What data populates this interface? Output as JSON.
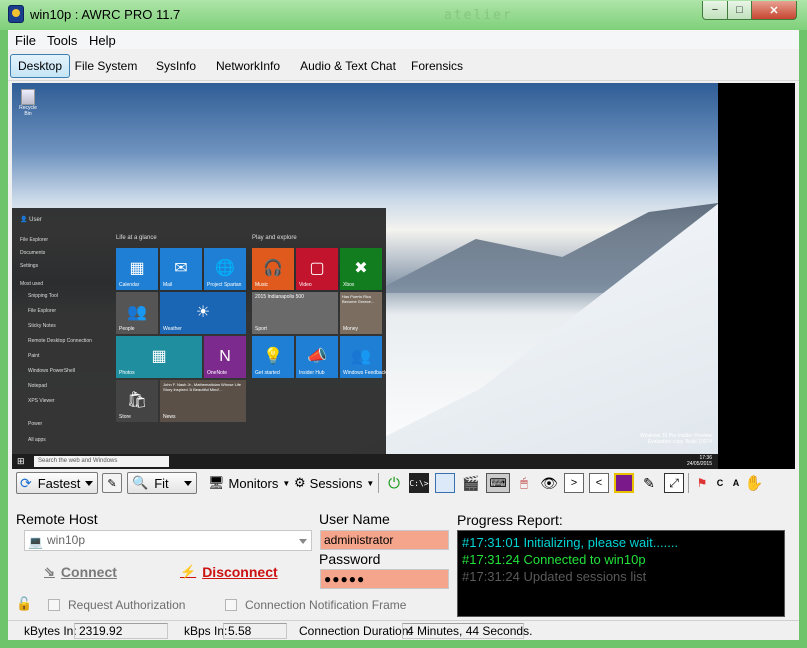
{
  "window": {
    "title": "win10p : AWRC PRO 11.7",
    "watermark": "atelier",
    "min_glyph": "−",
    "max_glyph": "□",
    "close_glyph": "✕"
  },
  "menu": {
    "items": [
      "File",
      "Tools",
      "Help"
    ]
  },
  "tabs": [
    {
      "label": "Desktop",
      "active": true
    },
    {
      "label": "File System",
      "active": false
    },
    {
      "label": "SysInfo",
      "active": false
    },
    {
      "label": "NetworkInfo",
      "active": false
    },
    {
      "label": "Audio & Text Chat",
      "active": false
    },
    {
      "label": "Forensics",
      "active": false
    }
  ],
  "remote_screen": {
    "recycle_bin_label": "Recycle Bin",
    "start_menu": {
      "user": "User",
      "places": [
        "File Explorer",
        "Documents",
        "Settings"
      ],
      "most_used_label": "Most used",
      "most_used": [
        "Snipping Tool",
        "File Explorer",
        "Sticky Notes",
        "Remote Desktop Connection",
        "Paint",
        "Windows PowerShell",
        "Notepad",
        "XPS Viewer"
      ],
      "power_label": "Power",
      "all_apps_label": "All apps",
      "group_life": "Life at a glance",
      "group_play": "Play and explore",
      "tiles": [
        "Calendar",
        "Mail",
        "Project Spartan",
        "Music",
        "Video",
        "Xbox",
        "People",
        "Weather",
        "Sport",
        "Money",
        "Photos",
        "OneNote",
        "Get started",
        "Insider Hub",
        "Windows Feedback",
        "Store",
        "News"
      ],
      "tile_headlines": {
        "sport": "2015 Indianapolis 500",
        "money": "Has Puerto Rico Become Greece...",
        "news": "John F. Nash Jr., Mathematician Whose Life Story Inspired 'A Beautiful Mind'..."
      }
    },
    "taskbar_search": "Search the web and Windows",
    "clock_time": "17:36",
    "clock_date": "24/05/2015",
    "watermark_line1": "Windows 10 Pro Insider Preview",
    "watermark_line2": "Evaluation copy. Build 10074"
  },
  "toolbar": {
    "speed_value": "Fastest",
    "scale_value": "Fit",
    "monitors_label": "Monitors",
    "sessions_label": "Sessions",
    "icon_names": [
      "power-icon",
      "command-prompt-icon",
      "window-icon",
      "clapperboard-icon",
      "keyboard-icon",
      "mouse-icon",
      "eye-icon",
      "script-next-icon",
      "script-prev-icon",
      "monitor-icon",
      "edit-icon",
      "fullscreen-icon",
      "windows-flag-icon",
      "text-c-icon",
      "text-a-icon",
      "hand-icon"
    ]
  },
  "connection": {
    "remote_host_label": "Remote Host",
    "remote_host_value": "win10p",
    "connect_label": "Connect",
    "disconnect_label": "Disconnect",
    "user_name_label": "User Name",
    "user_name_value": "administrator",
    "password_label": "Password",
    "password_value": "●●●●●",
    "request_authorization_label": "Request Authorization",
    "connection_notification_label": "Connection Notification Frame"
  },
  "progress": {
    "label": "Progress Report:",
    "lines": [
      {
        "text": "#17:31:01 Initializing, please wait.......",
        "color": "#00d4d4"
      },
      {
        "text": "#17:31:24 Connected to win10p",
        "color": "#23e23a"
      },
      {
        "text": "#17:31:24 Updated sessions list",
        "color": "#5a5a5a"
      }
    ]
  },
  "status": {
    "kbytes_in_label": "kBytes In:",
    "kbytes_in_value": "2319.92",
    "kbps_in_label": "kBps In:",
    "kbps_in_value": "5.58",
    "duration_label": "Connection Duration:",
    "duration_value": "4 Minutes, 44 Seconds."
  },
  "colors": {
    "title_green": "#7fd07a",
    "field_highlight": "#f5a58c",
    "disconnect_red": "#cc1111"
  }
}
